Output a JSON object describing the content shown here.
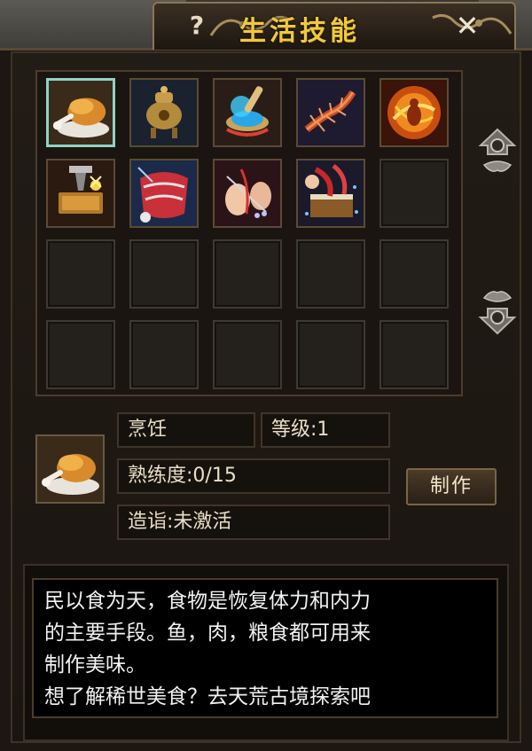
{
  "window": {
    "title": "生活技能",
    "help_label": "?",
    "close_label": "✕"
  },
  "skills": [
    {
      "name": "roast-chicken-icon",
      "selected": true
    },
    {
      "name": "incense-burner-icon"
    },
    {
      "name": "mortar-potion-icon"
    },
    {
      "name": "centipede-icon"
    },
    {
      "name": "fire-spirit-icon"
    },
    {
      "name": "forge-anvil-icon"
    },
    {
      "name": "tailoring-cloth-icon"
    },
    {
      "name": "needlework-icon"
    },
    {
      "name": "book-crafting-icon"
    }
  ],
  "total_slots": 20,
  "detail": {
    "skill_name": "烹饪",
    "level": "等级:1",
    "proficiency": "熟练度:0/15",
    "mastery": "造诣:未激活",
    "make_button": "制作"
  },
  "description": {
    "lines": [
      "民以食为天，食物是恢复体力和内力",
      "的主要手段。鱼，肉，粮食都可用来",
      "制作美味。",
      "想了解稀世美食？去天荒古境探索吧"
    ]
  }
}
